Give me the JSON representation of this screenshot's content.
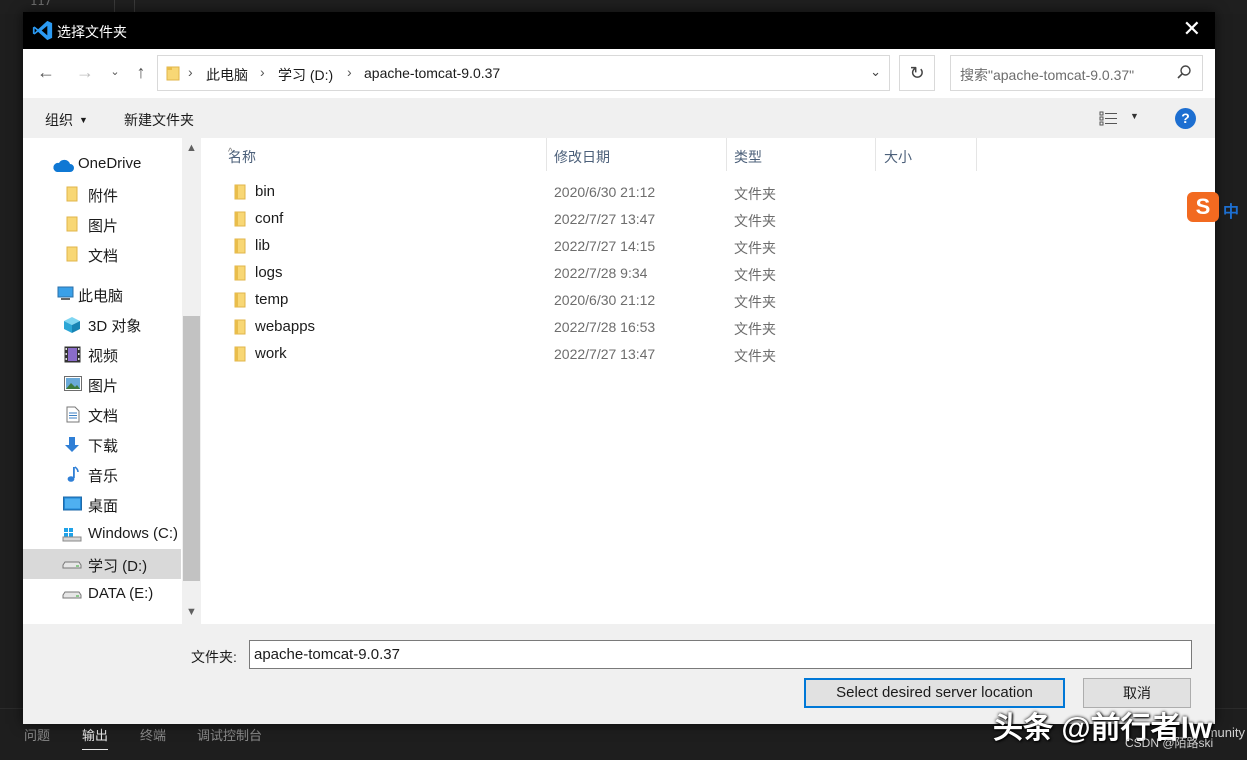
{
  "dialog": {
    "title": "选择文件夹",
    "close": "✕"
  },
  "nav": {
    "breadcrumbs": [
      "此电脑",
      "学习 (D:)",
      "apache-tomcat-9.0.37"
    ],
    "search_placeholder": "搜索\"apache-tomcat-9.0.37\""
  },
  "toolbar": {
    "organize": "组织",
    "new_folder": "新建文件夹",
    "help": "?"
  },
  "sidebar": {
    "items": [
      {
        "label": "OneDrive",
        "icon": "cloud-icon"
      },
      {
        "label": "附件",
        "icon": "folder-icon"
      },
      {
        "label": "图片",
        "icon": "folder-icon"
      },
      {
        "label": "文档",
        "icon": "folder-icon"
      },
      {
        "label": "此电脑",
        "icon": "computer-icon"
      },
      {
        "label": "3D 对象",
        "icon": "cube-icon"
      },
      {
        "label": "视频",
        "icon": "video-icon"
      },
      {
        "label": "图片",
        "icon": "picture-icon"
      },
      {
        "label": "文档",
        "icon": "document-icon"
      },
      {
        "label": "下载",
        "icon": "download-icon"
      },
      {
        "label": "音乐",
        "icon": "music-icon"
      },
      {
        "label": "桌面",
        "icon": "desktop-icon"
      },
      {
        "label": "Windows (C:)",
        "icon": "windows-drive-icon"
      },
      {
        "label": "学习 (D:)",
        "icon": "drive-icon"
      },
      {
        "label": "DATA (E:)",
        "icon": "drive-icon"
      }
    ]
  },
  "filelist": {
    "columns": [
      "名称",
      "修改日期",
      "类型",
      "大小"
    ],
    "rows": [
      {
        "name": "bin",
        "date": "2020/6/30 21:12",
        "type": "文件夹"
      },
      {
        "name": "conf",
        "date": "2022/7/27 13:47",
        "type": "文件夹"
      },
      {
        "name": "lib",
        "date": "2022/7/27 14:15",
        "type": "文件夹"
      },
      {
        "name": "logs",
        "date": "2022/7/28 9:34",
        "type": "文件夹"
      },
      {
        "name": "temp",
        "date": "2020/6/30 21:12",
        "type": "文件夹"
      },
      {
        "name": "webapps",
        "date": "2022/7/28 16:53",
        "type": "文件夹"
      },
      {
        "name": "work",
        "date": "2022/7/27 13:47",
        "type": "文件夹"
      }
    ]
  },
  "bottom": {
    "folder_label": "文件夹:",
    "folder_value": "apache-tomcat-9.0.37",
    "select_button": "Select desired server location",
    "cancel_button": "取消"
  },
  "background": {
    "line_fragment": "117",
    "panel_tabs": [
      "问题",
      "输出",
      "终端",
      "调试控制台"
    ],
    "panel_right": "munity"
  },
  "ime": {
    "logo": "S",
    "mode": "中"
  },
  "watermark": {
    "main": "头条 @前行者lw",
    "csdn": "CSDN @陌路ski"
  }
}
